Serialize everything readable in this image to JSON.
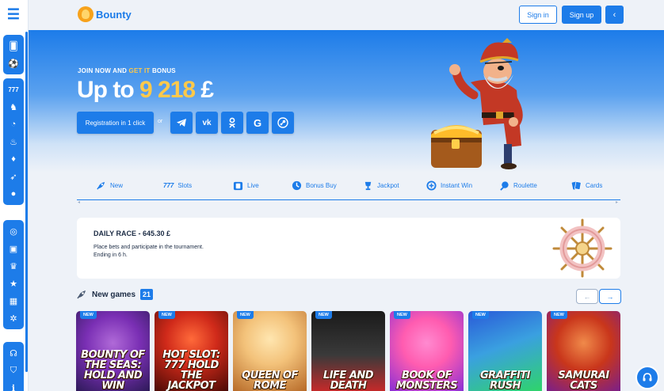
{
  "header": {
    "brand": "Bounty",
    "sign_in": "Sign in",
    "sign_up": "Sign up",
    "collapse": "‹"
  },
  "sidebar": {
    "menu_icon": "hamburger-icon",
    "groups": [
      [
        "cards-icon",
        "soccer-ball-icon"
      ],
      [
        "slots-777-icon",
        "live-icon",
        "bonus-buy-icon",
        "fire-icon",
        "drop-icon",
        "rocket-icon",
        "bomb-icon"
      ],
      [
        "poker-chip-icon",
        "gift-icon",
        "trophy-icon",
        "star-icon",
        "present-icon",
        "wheel-icon"
      ],
      [
        "headset-icon",
        "shield-icon",
        "info-icon"
      ]
    ]
  },
  "hero": {
    "kicker_a": "JOIN NOW AND ",
    "kicker_b": "GET IT",
    "kicker_c": " BONUS",
    "amount_a": "Up to ",
    "amount_b": "9 218",
    "amount_c": " £",
    "register": "Registration in 1 click",
    "or": "or",
    "socials": [
      "telegram-icon",
      "vk-icon",
      "odnoklassniki-icon",
      "google-icon",
      "steam-icon"
    ],
    "accent_color": "#ffc94a"
  },
  "categories": [
    {
      "label": "New",
      "icon": "rocket-icon"
    },
    {
      "label": "Slots",
      "icon": "slots-777-icon"
    },
    {
      "label": "Live",
      "icon": "live-icon"
    },
    {
      "label": "Bonus Buy",
      "icon": "bonus-buy-icon"
    },
    {
      "label": "Jackpot",
      "icon": "trophy-icon"
    },
    {
      "label": "Instant Win",
      "icon": "instant-win-icon"
    },
    {
      "label": "Roulette",
      "icon": "roulette-icon"
    },
    {
      "label": "Cards",
      "icon": "cards-icon"
    }
  ],
  "race": {
    "title": "DAILY RACE - 645.30 £",
    "line1": "Place bets and participate in the tournament.",
    "line2": "Ending in 6 h."
  },
  "new_games": {
    "title": "New games",
    "count": "21",
    "prev": "←",
    "next": "→",
    "badge": "NEW",
    "games": [
      {
        "title": "BOUNTY OF THE SEAS: HOLD AND WIN",
        "colors": [
          "#7a2fb4",
          "#2d1a58"
        ]
      },
      {
        "title": "HOT SLOT: 777 HOLD THE JACKPOT",
        "colors": [
          "#d02a1a",
          "#4a0a05"
        ]
      },
      {
        "title": "QUEEN OF ROME",
        "colors": [
          "#f3c27a",
          "#b76a28"
        ]
      },
      {
        "title": "LIFE AND DEATH",
        "colors": [
          "#1a1a1a",
          "#c42a2a"
        ]
      },
      {
        "title": "BOOK OF MONSTERS",
        "colors": [
          "#ff5cb0",
          "#8a2fd4"
        ]
      },
      {
        "title": "GRAFFITI RUSH",
        "colors": [
          "#2a5ad8",
          "#2fd46a"
        ]
      },
      {
        "title": "SAMURAI CATS",
        "colors": [
          "#c9361b",
          "#7a1f8a"
        ]
      }
    ]
  },
  "support": "headset-icon"
}
